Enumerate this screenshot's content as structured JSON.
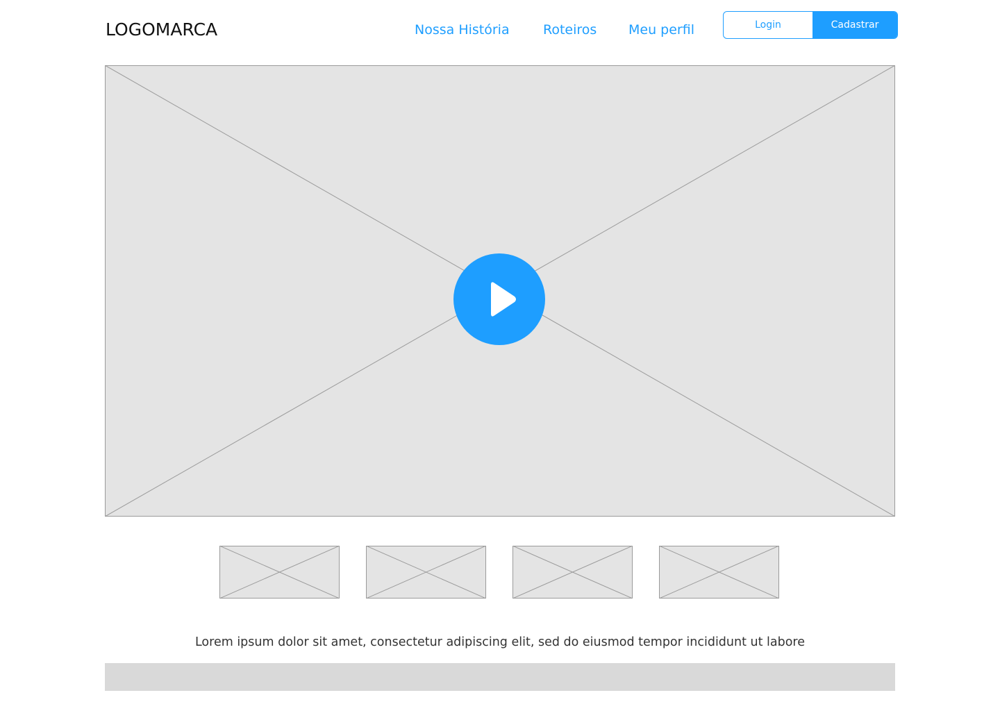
{
  "header": {
    "logo": "LOGOMARCA",
    "nav": [
      {
        "label": "Nossa História"
      },
      {
        "label": "Roteiros"
      },
      {
        "label": "Meu perfil"
      }
    ],
    "login_label": "Login",
    "signup_label": "Cadastrar"
  },
  "main": {
    "video": {
      "icon": "play-icon",
      "state": "paused"
    },
    "thumbnails": [
      {
        "icon": "image-placeholder-icon"
      },
      {
        "icon": "image-placeholder-icon"
      },
      {
        "icon": "image-placeholder-icon"
      },
      {
        "icon": "image-placeholder-icon"
      }
    ],
    "description": "Lorem ipsum dolor sit amet, consectetur adipiscing elit, sed do eiusmod tempor incididunt ut labore"
  },
  "colors": {
    "accent": "#1e9eff",
    "placeholder_fill": "#e4e4e4",
    "placeholder_stroke": "#9a9a9a",
    "footer_fill": "#d9d9d9",
    "text_dark": "#111111"
  }
}
